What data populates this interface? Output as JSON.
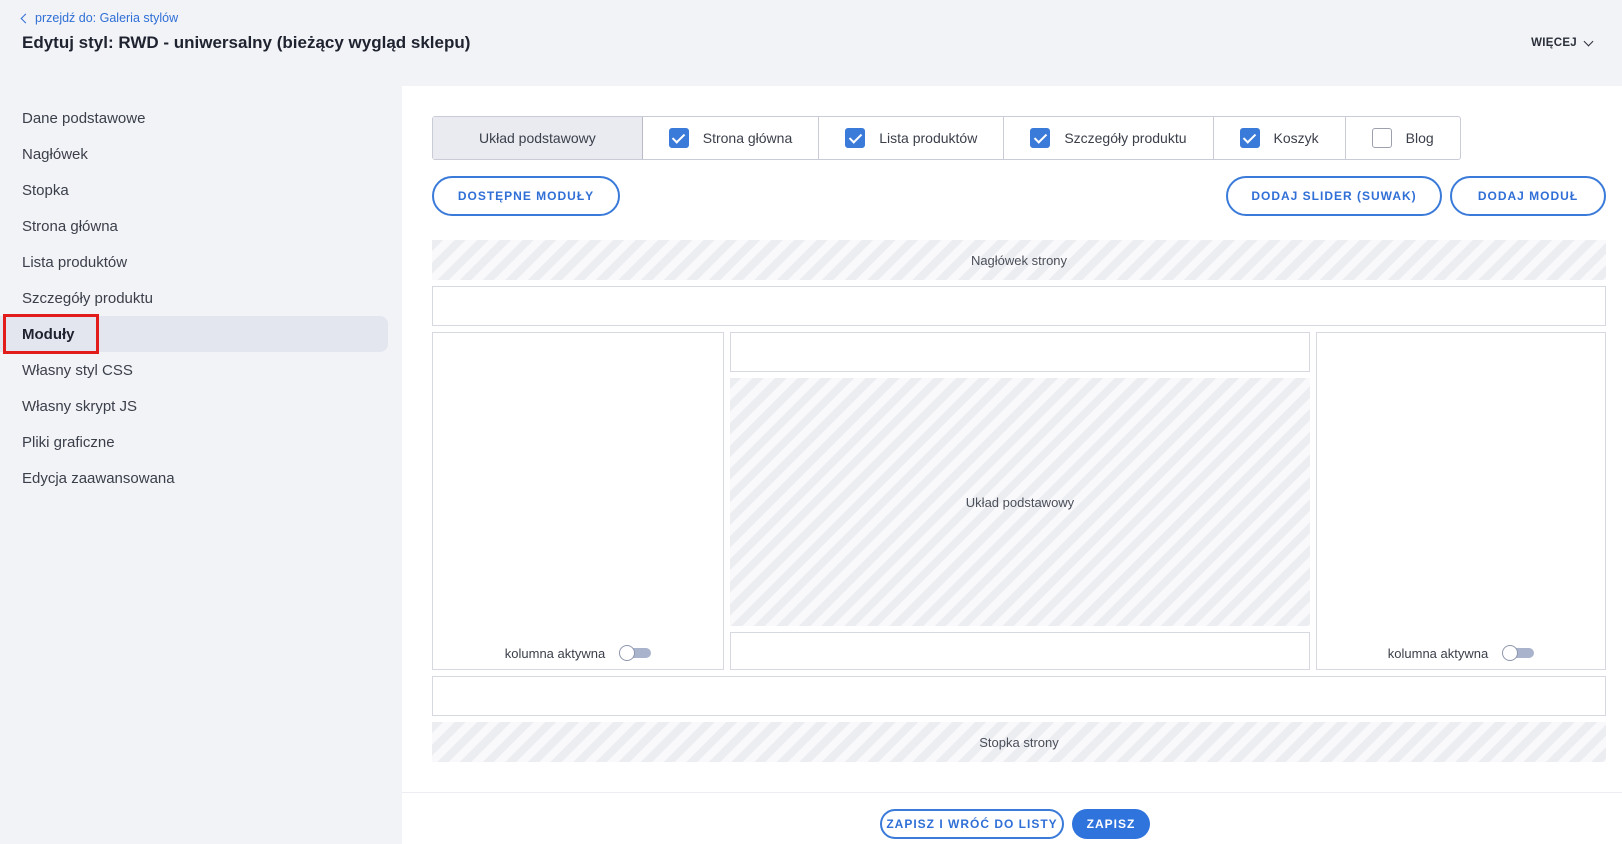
{
  "header": {
    "back_link": "przejdź do: Galeria stylów",
    "title": "Edytuj styl: RWD - uniwersalny (bieżący wygląd sklepu)",
    "more": "WIĘCEJ"
  },
  "sidebar": {
    "items": [
      {
        "label": "Dane podstawowe"
      },
      {
        "label": "Nagłówek"
      },
      {
        "label": "Stopka"
      },
      {
        "label": "Strona główna"
      },
      {
        "label": "Lista produktów"
      },
      {
        "label": "Szczegóły produktu"
      },
      {
        "label": "Moduły",
        "active": true
      },
      {
        "label": "Własny styl CSS"
      },
      {
        "label": "Własny skrypt JS"
      },
      {
        "label": "Pliki graficzne"
      },
      {
        "label": "Edycja zaawansowana"
      }
    ]
  },
  "tabs": [
    {
      "label": "Układ podstawowy",
      "checkbox": false,
      "active": true
    },
    {
      "label": "Strona główna",
      "checkbox": true,
      "checked": true
    },
    {
      "label": "Lista produktów",
      "checkbox": true,
      "checked": true
    },
    {
      "label": "Szczegóły produktu",
      "checkbox": true,
      "checked": true
    },
    {
      "label": "Koszyk",
      "checkbox": true,
      "checked": true
    },
    {
      "label": "Blog",
      "checkbox": true,
      "checked": false
    }
  ],
  "buttons": {
    "available_modules": "DOSTĘPNE MODUŁY",
    "add_slider": "DODAJ SLIDER (SUWAK)",
    "add_module": "DODAJ MODUŁ",
    "save_and_back": "ZAPISZ I WRÓĆ DO LISTY",
    "save": "ZAPISZ"
  },
  "layout": {
    "header_zone": "Nagłówek strony",
    "center_zone": "Układ podstawowy",
    "footer_zone": "Stopka strony",
    "left_column_toggle": "kolumna aktywna",
    "right_column_toggle": "kolumna aktywna"
  },
  "colors": {
    "accent": "#3a7ad9",
    "highlight_box": "#e21b1b"
  }
}
